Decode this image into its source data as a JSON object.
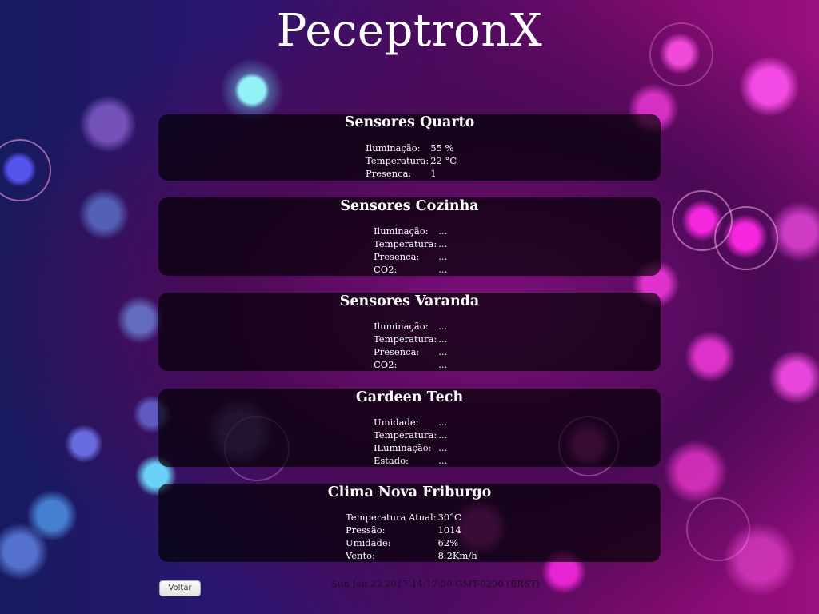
{
  "header": {
    "title": "PeceptronX"
  },
  "panels": [
    {
      "title": "Sensores Quarto",
      "rows": [
        {
          "label": "Iluminação:",
          "value": "55 %"
        },
        {
          "label": "Temperatura:",
          "value": "22 °C"
        },
        {
          "label": "Presenca:",
          "value": "1"
        }
      ]
    },
    {
      "title": "Sensores Cozinha",
      "rows": [
        {
          "label": "Iluminação:",
          "value": "..."
        },
        {
          "label": "Temperatura:",
          "value": "..."
        },
        {
          "label": "Presenca:",
          "value": "..."
        },
        {
          "label": "CO2:",
          "value": "..."
        }
      ]
    },
    {
      "title": "Sensores Varanda",
      "rows": [
        {
          "label": "Iluminação:",
          "value": "..."
        },
        {
          "label": "Temperatura:",
          "value": "..."
        },
        {
          "label": "Presenca:",
          "value": "..."
        },
        {
          "label": "CO2:",
          "value": "..."
        }
      ]
    },
    {
      "title": "Gardeen Tech",
      "rows": [
        {
          "label": "Umidade:",
          "value": "..."
        },
        {
          "label": "Temperatura:",
          "value": "..."
        },
        {
          "label": "ILuminação:",
          "value": "..."
        },
        {
          "label": "Estado:",
          "value": "..."
        }
      ]
    },
    {
      "title": "Clima Nova Friburgo",
      "rows": [
        {
          "label": "Temperatura Atual:",
          "value": "30°C"
        },
        {
          "label": "Pressão:",
          "value": "1014"
        },
        {
          "label": "Umidade:",
          "value": "62%"
        },
        {
          "label": "Vento:",
          "value": "8.2Km/h"
        }
      ]
    }
  ],
  "footer": {
    "back_label": "Voltar",
    "datetime": "Sun Jan 22 2017 14:17:50 GMT-0200 (BRST)"
  }
}
